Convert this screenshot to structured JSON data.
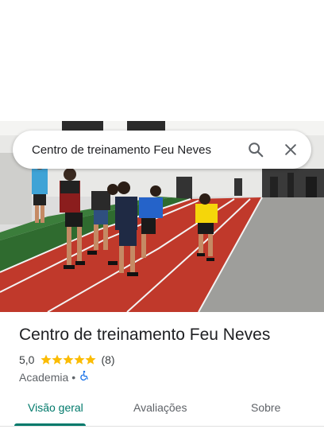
{
  "search": {
    "query": "Centro de treinamento Feu Neves",
    "search_icon": "search-icon",
    "close_icon": "close-icon"
  },
  "photo": {
    "description_icon": "gym-photo"
  },
  "place": {
    "name": "Centro de treinamento Feu Neves",
    "rating": "5,0",
    "stars": 5,
    "review_count": "(8)",
    "category": "Academia",
    "separator": "•",
    "accessibility_icon": "wheelchair-accessible-icon"
  },
  "tabs": [
    {
      "label": "Visão geral",
      "active": true
    },
    {
      "label": "Avaliações",
      "active": false
    },
    {
      "label": "Sobre",
      "active": false
    }
  ],
  "colors": {
    "accent": "#00796b",
    "star": "#fbbc04",
    "track_red": "#c62828",
    "turf_green": "#2e7d32",
    "accessibility_blue": "#1a73e8"
  }
}
